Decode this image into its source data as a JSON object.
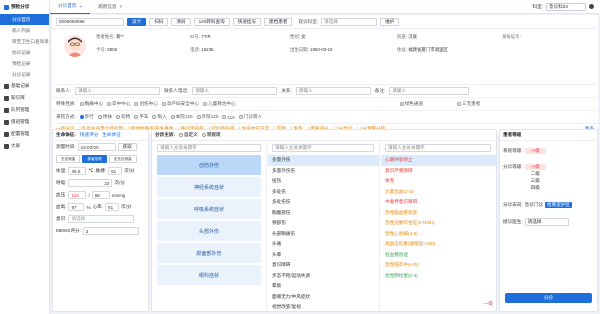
{
  "sidebar": {
    "title": "预检分诊",
    "items": [
      {
        "label": "预检分诊",
        "active": true
      },
      {
        "label": "分诊首页",
        "sub": true,
        "active": true
      },
      {
        "label": "病人列表",
        "sub": true
      },
      {
        "label": "转至卫生口查询单",
        "sub": true
      },
      {
        "label": "协诊记录",
        "sub": true
      },
      {
        "label": "预检记录",
        "sub": true
      },
      {
        "label": "分诊记录",
        "sub": true
      },
      {
        "label": "基础记录"
      },
      {
        "label": "知识库"
      },
      {
        "label": "队列管理"
      },
      {
        "label": "值班管理"
      },
      {
        "label": "配置管理"
      },
      {
        "label": "大屏"
      }
    ]
  },
  "topbar": {
    "tabs": [
      "分诊首页",
      "病例信息"
    ],
    "right_label": "科室:",
    "right_value": "急诊科03"
  },
  "search": {
    "value": "0000000086",
    "buttons": [
      "读卡",
      "扫码",
      "清屏",
      "120转科查询",
      "快速挂号",
      "建档患者"
    ],
    "dept_label": "就诊科室:",
    "dept_placeholder": "请选择",
    "maintain": "维护"
  },
  "patient": {
    "name_label": "患者姓名:",
    "name_value": "蒋**",
    "id_label": "ID号:",
    "id_value": "7TIP",
    "gender_label": "性别:",
    "gender_value": "女",
    "nation_label": "民族:",
    "nation_value": "汉族",
    "job_label": "身份证号:",
    "card_label": "卡号:",
    "card_value": "0006",
    "phone_label": "电话:",
    "phone_value": "15236",
    "birth_label": "出生日期:",
    "birth_value": "1950-03-10",
    "addr_label": "住址:",
    "addr_value": "福建省厦门市湖里区"
  },
  "reg": {
    "contact_label": "联系人:",
    "contact_ph": "请输入",
    "contact_phone_label": "联系人电话:",
    "contact_phone_ph": "请输入",
    "relation_label": "关系:",
    "relation_ph": "请输入",
    "remark_label": "备注:",
    "remark_ph": "请输入",
    "green_label": "绿色通道",
    "nature_label": "三无患者",
    "special_label": "特殊性质:",
    "special_opts": [
      "胸痛中心",
      "卒中中心",
      "创伤中心",
      "孕产妇安全中心",
      "儿童救治中心"
    ],
    "arrive_label": "来院方式:",
    "arrive_opts": [
      "步行",
      "搀扶",
      "轮椅",
      "平车",
      "抱入",
      "本院120",
      "外院120",
      "110",
      "门诊转入"
    ]
  },
  "tags": [
    "一级分诊",
    "| 危及生命需立即处理",
    "| 群体性事件/突发事件",
    "| 确诊传染病",
    "| 疑似传染病",
    "| 生命体征异常",
    "| 其他",
    "| 发热",
    "| 疼痛评分",
    "| 1分急诊",
    "| 1分预警分级"
  ],
  "tags_more": "更多",
  "vitals": {
    "title": "生命体征:",
    "link1": "快速评分",
    "link2": "生命体征",
    "time_label": "测量时间:",
    "time_value": "15:03:00",
    "fetch": "获取",
    "modes": [
      "无法测量",
      "患者拒测",
      "无无法测量"
    ],
    "temp_label": "体温:",
    "temp_value": "36.5",
    "temp_unit": "℃",
    "pulse_label": "脉搏:",
    "pulse_value": "61",
    "pulse_unit": "次/分",
    "resp_label": "呼吸:",
    "resp_value": "22",
    "resp_unit": "次/分",
    "bp_label": "血压:",
    "bp_sys": "115",
    "bp_dia": "68",
    "bp_unit": "mmHg",
    "spo2_label": "血氧:",
    "spo2_value": "97",
    "spo2_unit": "%",
    "hr_label": "心率:",
    "hr_value": "61",
    "hr_unit": "次/分",
    "conscious_label": "意识:",
    "conscious_ph": "请选择",
    "mews_label": "MEWS评分:",
    "mews_value": "2"
  },
  "complaint": {
    "title": "分诊主诉:",
    "opt1": "自定义",
    "opt2": "常规项",
    "cat_search_ph": "请输入主诉关键字",
    "categories": [
      "创伤外伤",
      "神经系统症状",
      "呼吸系统症状",
      "头部外伤",
      "颜面部外伤",
      "眼科症状"
    ],
    "symptom_search_ph": "请输入主诉关键字",
    "symptoms": [
      "多量外伤",
      "多量外伤伤",
      "扭伤",
      "多处伤",
      "多处伤伤",
      "胸腹部伤",
      "颈部伤",
      "头部胸痛伤",
      "头痛",
      "头晕",
      "意识障碍",
      "步态不稳/运动失调",
      "晕厥",
      "面瘫无力/中风症状",
      "视觉改变/复视"
    ],
    "grade_search_ph": "请输入主诉关键字",
    "grades": [
      "心跳呼吸停止",
      "意识严重障碍",
      "休克",
      "大量出血(2-3)",
      "中毒伴意识障碍",
      "急性脑血管病变",
      "急性冠脉综合征(STEMI)",
      "急性心衰竭(4-5)",
      "高血压危象(收缩压>180)",
      "低血糖昏迷",
      "急性脑卒中(<4h)",
      "急性肺栓塞(2-4)"
    ],
    "grade_footer": "一级"
  },
  "level": {
    "title": "患者等级",
    "sys_label": "系统等级:",
    "sys_value": "一级",
    "triage_label": "分诊等级:",
    "triage_opts": [
      "一级",
      "二级",
      "三级",
      "四级"
    ],
    "area_label": "分诊去向:",
    "area_value": "急诊门诊",
    "area_tag": "抢救室护区",
    "doctor_label": "接诊医生:",
    "doctor_value": "请选择",
    "submit": "分诊"
  }
}
